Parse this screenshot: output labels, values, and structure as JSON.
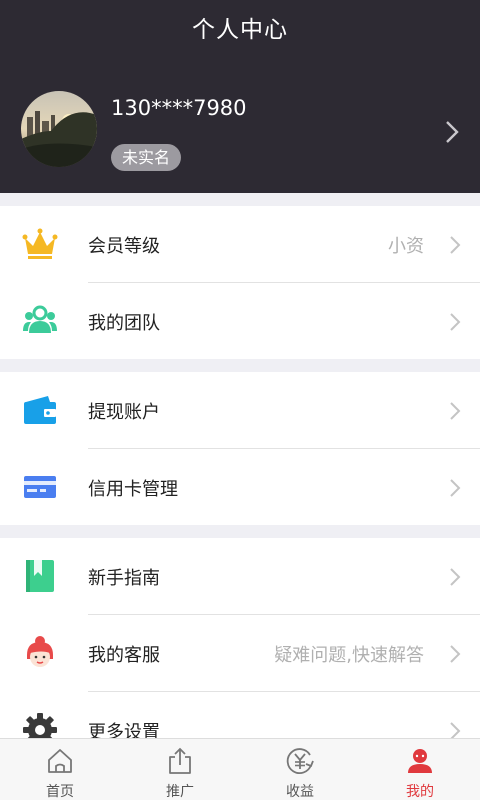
{
  "header": {
    "title": "个人中心",
    "phone": "130****7980",
    "badge": "未实名"
  },
  "sections": [
    {
      "items": [
        {
          "label": "会员等级",
          "value": "小资",
          "icon": "crown-icon"
        },
        {
          "label": "我的团队",
          "value": "",
          "icon": "team-icon"
        }
      ]
    },
    {
      "items": [
        {
          "label": "提现账户",
          "value": "",
          "icon": "wallet-icon"
        },
        {
          "label": "信用卡管理",
          "value": "",
          "icon": "credit-card-icon"
        }
      ]
    },
    {
      "items": [
        {
          "label": "新手指南",
          "value": "",
          "icon": "guide-book-icon"
        },
        {
          "label": "我的客服",
          "value": "疑难问题,快速解答",
          "icon": "customer-service-icon"
        },
        {
          "label": "更多设置",
          "value": "",
          "icon": "gear-icon"
        }
      ]
    }
  ],
  "tabbar": {
    "tabs": [
      {
        "label": "首页",
        "icon": "home-icon"
      },
      {
        "label": "推广",
        "icon": "share-icon"
      },
      {
        "label": "收益",
        "icon": "income-icon"
      },
      {
        "label": "我的",
        "icon": "profile-icon"
      }
    ],
    "active_index": 3
  },
  "colors": {
    "header_bg": "#2d2a33",
    "accent_red": "#e0393e",
    "crown": "#f5b823",
    "team": "#3ccb9a",
    "wallet": "#18a0e8",
    "card": "#4a7ef0",
    "guide": "#3dcf8e"
  }
}
